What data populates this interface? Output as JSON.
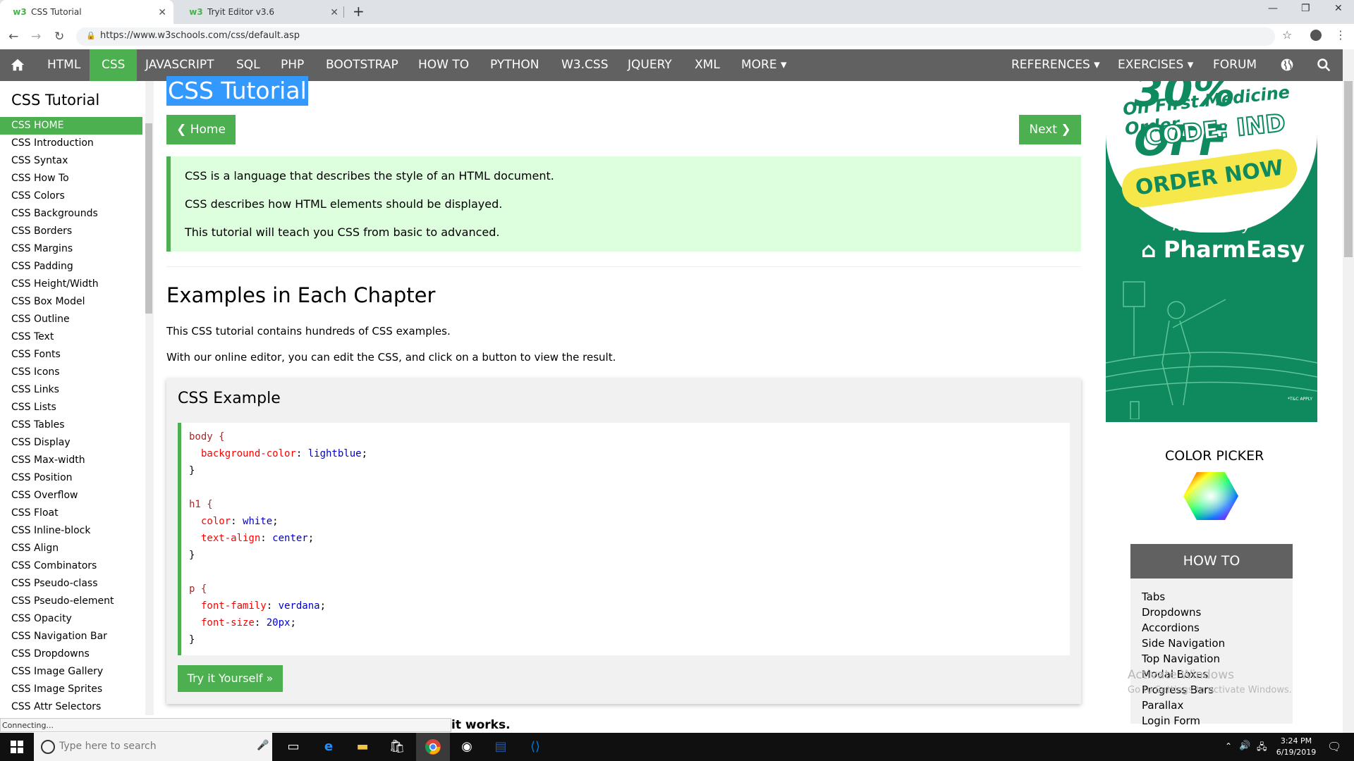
{
  "browser": {
    "tabs": [
      {
        "title": "CSS Tutorial",
        "active": true
      },
      {
        "title": "Tryit Editor v3.6",
        "active": false
      }
    ],
    "url": "https://www.w3schools.com/css/default.asp"
  },
  "nav": {
    "items": [
      "HTML",
      "CSS",
      "JAVASCRIPT",
      "SQL",
      "PHP",
      "BOOTSTRAP",
      "HOW TO",
      "PYTHON",
      "W3.CSS",
      "JQUERY",
      "XML",
      "MORE ▾"
    ],
    "right_items": [
      "REFERENCES ▾",
      "EXERCISES ▾",
      "FORUM"
    ],
    "active": "CSS"
  },
  "sidebar": {
    "title": "CSS Tutorial",
    "items": [
      "CSS HOME",
      "CSS Introduction",
      "CSS Syntax",
      "CSS How To",
      "CSS Colors",
      "CSS Backgrounds",
      "CSS Borders",
      "CSS Margins",
      "CSS Padding",
      "CSS Height/Width",
      "CSS Box Model",
      "CSS Outline",
      "CSS Text",
      "CSS Fonts",
      "CSS Icons",
      "CSS Links",
      "CSS Lists",
      "CSS Tables",
      "CSS Display",
      "CSS Max-width",
      "CSS Position",
      "CSS Overflow",
      "CSS Float",
      "CSS Inline-block",
      "CSS Align",
      "CSS Combinators",
      "CSS Pseudo-class",
      "CSS Pseudo-element",
      "CSS Opacity",
      "CSS Navigation Bar",
      "CSS Dropdowns",
      "CSS Image Gallery",
      "CSS Image Sprites",
      "CSS Attr Selectors"
    ]
  },
  "status_text": "Connecting...",
  "main": {
    "title": "CSS Tutorial",
    "home_button": "❮ Home",
    "next_button": "Next ❯",
    "intro": [
      "CSS is a language that describes the style of an HTML document.",
      "CSS describes how HTML elements should be displayed.",
      "This tutorial will teach you CSS from basic to advanced."
    ],
    "section_title": "Examples in Each Chapter",
    "p1": "This CSS tutorial contains hundreds of CSS examples.",
    "p2": "With our online editor, you can edit the CSS, and click on a button to view the result.",
    "example_title": "CSS Example",
    "code": {
      "body_sel": "body {",
      "body_prop": "background-color",
      "body_val": "lightblue",
      "h1_sel": "h1 {",
      "h1_prop1": "color",
      "h1_val1": "white",
      "h1_prop2": "text-align",
      "h1_val2": "center",
      "p_sel": "p {",
      "p_prop1": "font-family",
      "p_val1": "verdana",
      "p_prop2": "font-size",
      "p_val2": "20px",
      "close": "}"
    },
    "try_button": "Try it Yourself »",
    "cut_text": "it works."
  },
  "ad": {
    "big": "30% OFF",
    "sub": "On First Medicine Order",
    "code": "CODE: IND",
    "order": "ORDER NOW",
    "tagline": "Take it easy",
    "brand": "PharmEasy",
    "tc": "*T&C APPLY"
  },
  "color_picker": {
    "title": "COLOR PICKER"
  },
  "howto": {
    "title": "HOW TO",
    "items": [
      "Tabs",
      "Dropdowns",
      "Accordions",
      "Side Navigation",
      "Top Navigation",
      "Modal Boxes",
      "Progress Bars",
      "Parallax",
      "Login Form"
    ]
  },
  "watermark": {
    "line1": "Activate Windows",
    "line2": "Go to Settings to activate Windows."
  },
  "taskbar": {
    "search_placeholder": "Type here to search",
    "time": "3:24 PM",
    "date": "6/19/2019"
  },
  "colors": {
    "accent": "#4CAF50",
    "nav_bg": "#616161",
    "intro_bg": "#ddffdd",
    "selection": "#3399ff"
  }
}
